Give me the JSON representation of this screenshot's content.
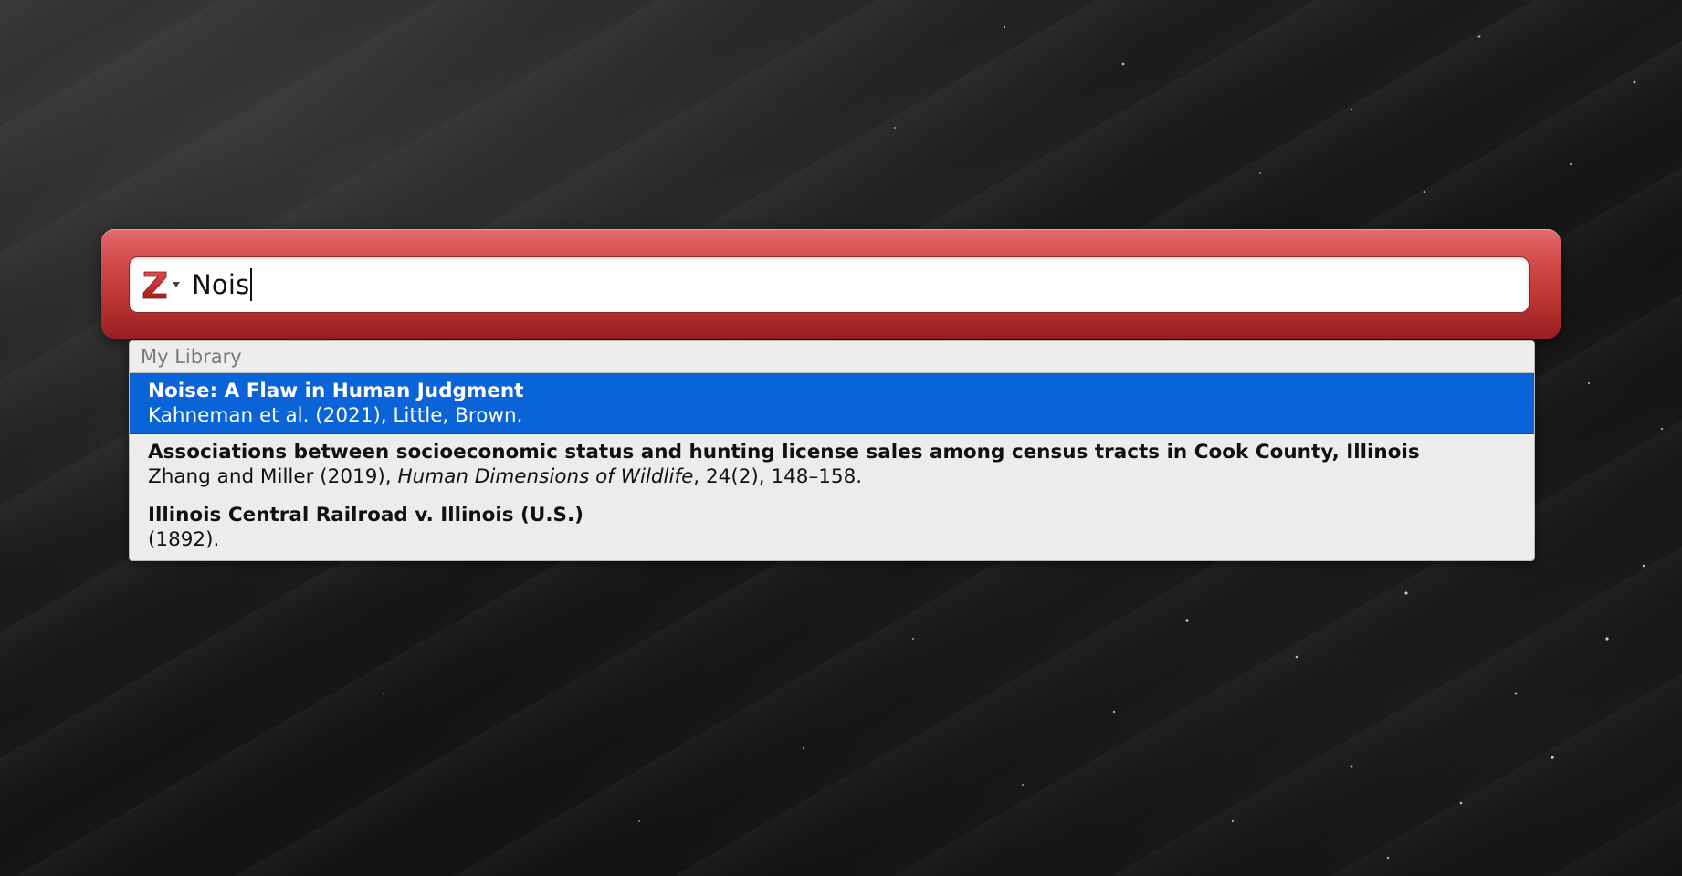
{
  "search": {
    "query": "Nois",
    "logo_icon": "zotero-z-icon",
    "menu_icon": "chevron-down-icon"
  },
  "results": {
    "section_label": "My Library",
    "items": [
      {
        "title": "Noise: A Flaw in Human Judgment",
        "cite_before": "Kahneman et al. (2021), Little, Brown.",
        "cite_italic": "",
        "cite_after": "",
        "selected": true
      },
      {
        "title": "Associations between socioeconomic status and hunting license sales among census tracts in Cook County, Illinois",
        "cite_before": "Zhang and Miller (2019), ",
        "cite_italic": "Human Dimensions of Wildlife",
        "cite_after": ", 24(2), 148–158.",
        "selected": false
      },
      {
        "title": "Illinois Central Railroad v. Illinois (U.S.)",
        "cite_before": "(1892).",
        "cite_italic": "",
        "cite_after": "",
        "selected": false
      }
    ]
  },
  "colors": {
    "frame_red": "#c43a3a",
    "selection_blue": "#0b63d8",
    "list_bg": "#ececec"
  }
}
